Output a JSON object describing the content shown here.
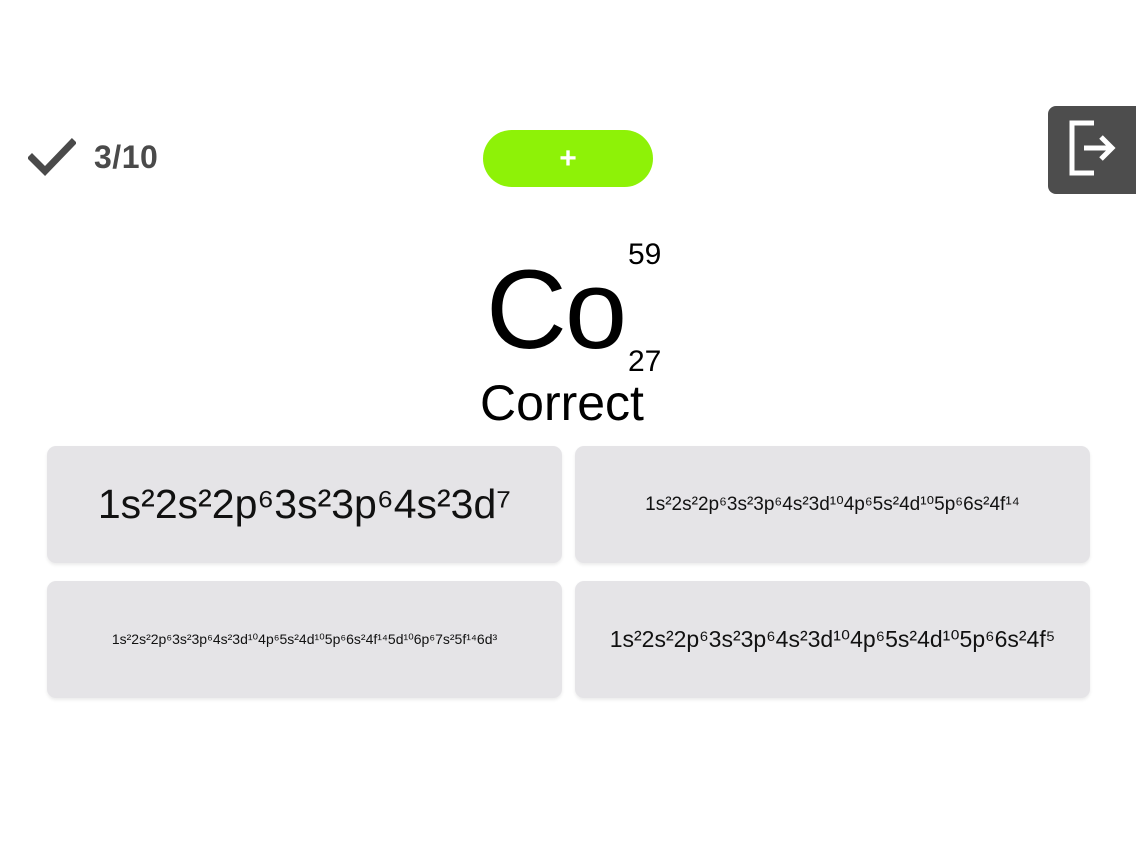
{
  "score": {
    "text": "3/10",
    "icon": "checkmark-icon"
  },
  "hint_button": {
    "label": "+",
    "color": "#8ef207"
  },
  "exit_button": {
    "icon": "exit-icon",
    "color": "#4d4d4d"
  },
  "element": {
    "symbol": "Co",
    "mass_number": "59",
    "atomic_number": "27"
  },
  "feedback": "Correct",
  "options": [
    "1s²2s²2p⁶3s²3p⁶4s²3d⁷",
    "1s²2s²2p⁶3s²3p⁶4s²3d¹⁰4p⁶5s²4d¹⁰5p⁶6s²4f¹⁴",
    "1s²2s²2p⁶3s²3p⁶4s²3d¹⁰4p⁶5s²4d¹⁰5p⁶6s²4f¹⁴5d¹⁰6p⁶7s²5f¹⁴6d³",
    "1s²2s²2p⁶3s²3p⁶4s²3d¹⁰4p⁶5s²4d¹⁰5p⁶6s²4f⁵"
  ]
}
